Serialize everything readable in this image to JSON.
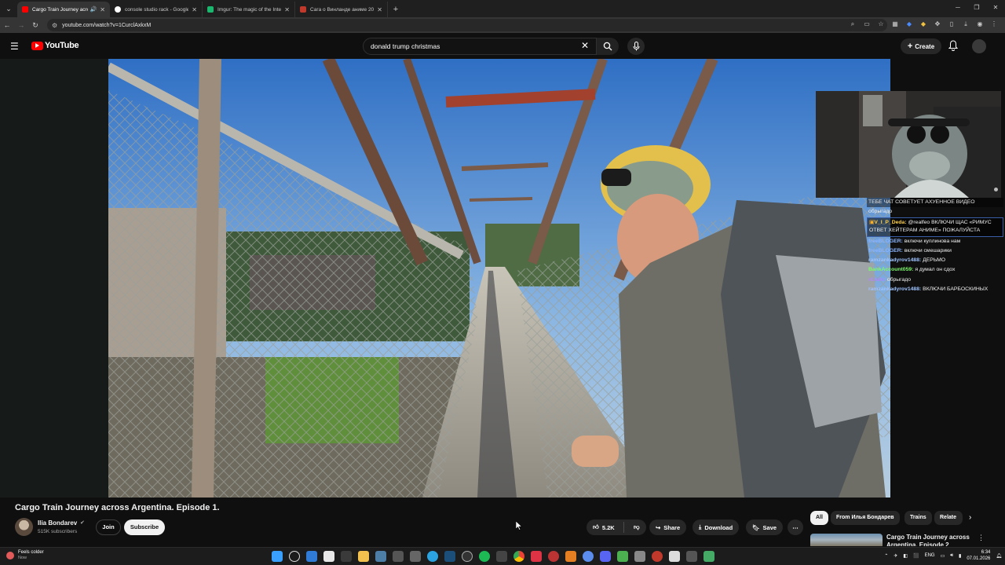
{
  "browser": {
    "tabs": [
      {
        "title": "Cargo Train Journey across",
        "active": true,
        "color": "#ff0000",
        "audio": true
      },
      {
        "title": "console studio rack - Google S",
        "active": false,
        "color": "#ffffff"
      },
      {
        "title": "Imgur: The magic of the Intern",
        "active": false,
        "color": "#1bb76e"
      },
      {
        "title": "Сага о Винланде аниме 2019",
        "active": false,
        "color": "#c0392b"
      }
    ],
    "url": "youtube.com/watch?v=1CurclAxkxM"
  },
  "youtube": {
    "logo_text": "YouTube",
    "search_query": "donald trump christmas",
    "create_label": "Create",
    "video": {
      "title": "Cargo Train Journey across Argentina. Episode 1.",
      "channel_name": "Ilia Bondarev",
      "subscribers": "515K subscribers",
      "join_label": "Join",
      "subscribe_label": "Subscribe",
      "likes": "5.2K",
      "share_label": "Share",
      "download_label": "Download",
      "save_label": "Save"
    },
    "chips": [
      "All",
      "From Илья Бондарев",
      "Trains",
      "Relate"
    ],
    "recommendation": {
      "title": "Cargo Train Journey across Argentina. Episode 2"
    }
  },
  "chat": {
    "banner": "ТЕБЕ ЧАТ СОВЕТУЕТ АХУЕННОЕ ВИДЕО",
    "messages": [
      {
        "user": "",
        "text": "обрыгадо",
        "color": "#b084ff"
      },
      {
        "user": "V_I_P_Deda:",
        "text": "@realfeo ВКЛЮЧИ ЩАС «РИМУС ОТВЕТ ХЕЙТЕРАМ АНИМЕ» ПОЖАЛУЙСТА",
        "color": "#ffd24a",
        "highlight": true
      },
      {
        "user": "freeBLOGER:",
        "text": "включи куплинова нам",
        "color": "#8ab4ff"
      },
      {
        "user": "freeBLOGER:",
        "text": "включи смешарики",
        "color": "#8ab4ff"
      },
      {
        "user": "ramzankadyrov1488:",
        "text": "ДЕРЬМО",
        "color": "#9ec3ff"
      },
      {
        "user": "BankAccount059:",
        "text": "я думал он сдох",
        "color": "#7cfc6a"
      },
      {
        "user": "v1ralx:",
        "text": "обрыгадо",
        "color": "#b084ff"
      },
      {
        "user": "ramzankadyrov1488:",
        "text": "ВКЛЮЧИ БАРБОСКИНЫХ",
        "color": "#9ec3ff"
      }
    ]
  },
  "taskbar": {
    "weather_line1": "Feels colder",
    "weather_line2": "Now",
    "language": "ENG",
    "time": "6:34",
    "date": "07.01.2026"
  }
}
